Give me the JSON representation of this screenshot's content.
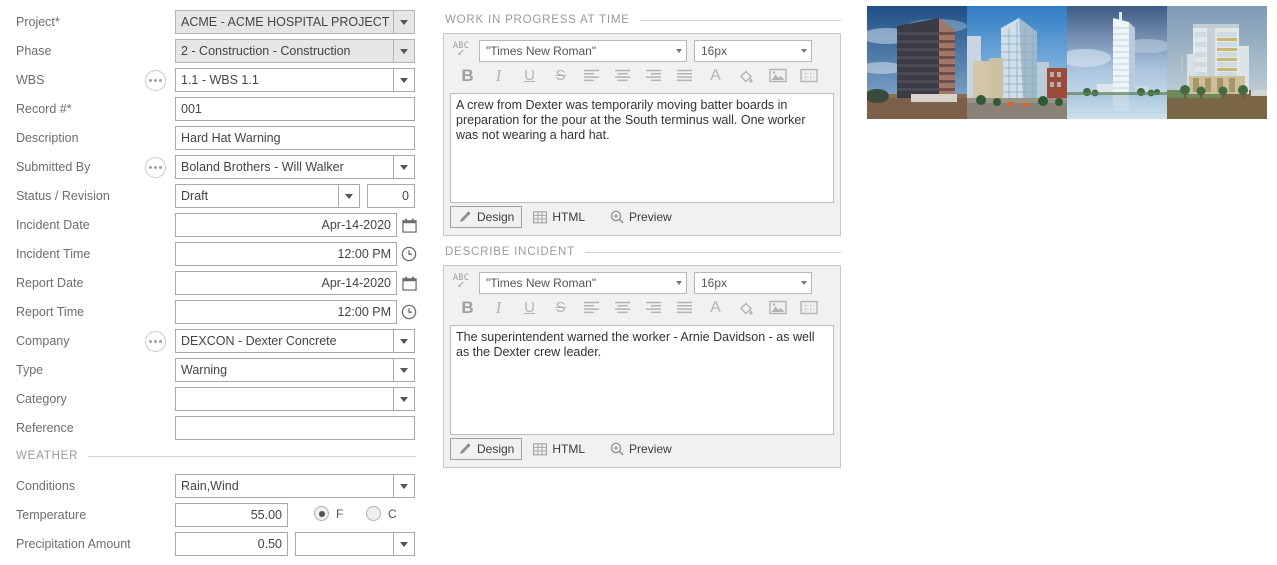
{
  "form": {
    "fields": [
      {
        "label": "Project*",
        "value": "ACME - ACME HOSPITAL PROJECT",
        "type": "combo",
        "disabled": true,
        "lookup": false
      },
      {
        "label": "Phase",
        "value": "2 - Construction - Construction",
        "type": "combo",
        "disabled": true,
        "lookup": false
      },
      {
        "label": "WBS",
        "value": "1.1 - WBS 1.1",
        "type": "combo",
        "disabled": false,
        "lookup": true
      },
      {
        "label": "Record #*",
        "value": "001",
        "type": "text",
        "disabled": false,
        "lookup": false
      },
      {
        "label": "Description",
        "value": "Hard Hat Warning",
        "type": "text",
        "disabled": false,
        "lookup": false
      },
      {
        "label": "Submitted By",
        "value": "Boland Brothers - Will Walker",
        "type": "combo",
        "disabled": false,
        "lookup": true
      },
      {
        "label": "Status / Revision",
        "value": "Draft",
        "type": "status",
        "revision": "0"
      },
      {
        "label": "Incident Date",
        "value": "Apr-14-2020",
        "type": "date",
        "icon": "calendar-icon"
      },
      {
        "label": "Incident Time",
        "value": "12:00 PM",
        "type": "date",
        "icon": "clock-icon"
      },
      {
        "label": "Report Date",
        "value": "Apr-14-2020",
        "type": "date",
        "icon": "calendar-icon"
      },
      {
        "label": "Report Time",
        "value": "12:00 PM",
        "type": "date",
        "icon": "clock-icon"
      },
      {
        "label": "Company",
        "value": "DEXCON - Dexter Concrete",
        "type": "combo",
        "disabled": false,
        "lookup": true
      },
      {
        "label": "Type",
        "value": "Warning",
        "type": "combo",
        "disabled": false,
        "lookup": false
      },
      {
        "label": "Category",
        "value": "",
        "type": "combo",
        "disabled": false,
        "lookup": false
      },
      {
        "label": "Reference",
        "value": "",
        "type": "text",
        "disabled": false,
        "lookup": false
      }
    ],
    "weather_section": "WEATHER",
    "weather": {
      "conditions_label": "Conditions",
      "conditions_value": "Rain,Wind",
      "temperature_label": "Temperature",
      "temperature_value": "55.00",
      "unit_f": "F",
      "unit_c": "C",
      "unit_selected": "F",
      "precipitation_label": "Precipitation Amount",
      "precipitation_value": "0.50",
      "precipitation_unit": ""
    }
  },
  "editors": [
    {
      "section_title": "WORK IN PROGRESS AT TIME",
      "font_family": "\"Times New Roman\"",
      "font_size": "16px",
      "body": "A crew from Dexter was temporarily moving batter boards in preparation for the pour at the South terminus wall. One worker was not wearing a hard hat.",
      "tabs": [
        {
          "label": "Design",
          "icon": "pencil-icon",
          "active": true
        },
        {
          "label": "HTML",
          "icon": "grid-icon",
          "active": false
        },
        {
          "label": "Preview",
          "icon": "magnifier-icon",
          "active": false
        }
      ]
    },
    {
      "section_title": "DESCRIBE INCIDENT",
      "font_family": "\"Times New Roman\"",
      "font_size": "16px",
      "body": "The superintendent warned the worker - Arnie Davidson - as well as the Dexter crew leader.",
      "tabs": [
        {
          "label": "Design",
          "icon": "pencil-icon",
          "active": true
        },
        {
          "label": "HTML",
          "icon": "grid-icon",
          "active": false
        },
        {
          "label": "Preview",
          "icon": "magnifier-icon",
          "active": false
        }
      ]
    }
  ],
  "toolbar_buttons": [
    {
      "name": "bold-icon",
      "glyph": "B"
    },
    {
      "name": "italic-icon",
      "glyph": "I"
    },
    {
      "name": "underline-icon",
      "glyph": "U"
    },
    {
      "name": "strikethrough-icon",
      "glyph": "S"
    },
    {
      "name": "align-left-icon",
      "glyph": ""
    },
    {
      "name": "align-center-icon",
      "glyph": ""
    },
    {
      "name": "align-right-icon",
      "glyph": ""
    },
    {
      "name": "align-justify-icon",
      "glyph": ""
    },
    {
      "name": "font-color-icon",
      "glyph": "A"
    },
    {
      "name": "fill-color-icon",
      "glyph": ""
    },
    {
      "name": "insert-image-icon",
      "glyph": ""
    },
    {
      "name": "insert-table-icon",
      "glyph": ""
    }
  ],
  "images": [
    {
      "name": "building-photo-1",
      "sky": "#2f5f96",
      "body": "#8a6a5c",
      "ground": "#8a6a52"
    },
    {
      "name": "building-photo-2",
      "sky": "#3f86c6",
      "body": "#b9cfe0",
      "ground": "#9a8f82"
    },
    {
      "name": "building-photo-3",
      "sky": "#5e7ea8",
      "body": "#d7e2ea",
      "ground": "#a8c2d4"
    },
    {
      "name": "building-photo-4",
      "sky": "#9fb4c9",
      "body": "#dfe6e6",
      "ground": "#7d6a4e"
    }
  ]
}
